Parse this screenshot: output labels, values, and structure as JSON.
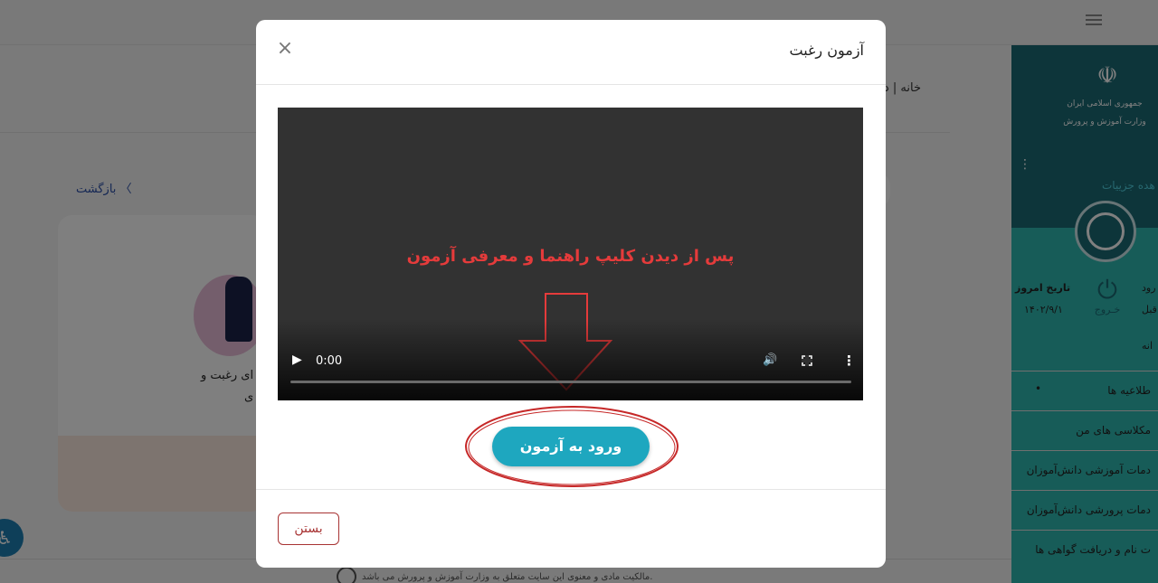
{
  "modal": {
    "title": "آزمون رغبت",
    "close_symbol": "×",
    "video": {
      "caption": "پس از دیدن کلیپ راهنما و معرفی آزمون",
      "time": "0:00",
      "play_symbol": "▶",
      "volume_symbol": "🔊",
      "more_symbol": "⋮"
    },
    "enter_button": "ورود به آزمون",
    "close_button": "بستن"
  },
  "background": {
    "breadcrumb": "خانه | د",
    "back_link": "بازگشت",
    "back_chevron": "〈",
    "card_text_line1": "ای رغبت و",
    "card_text_line2": "ی",
    "footer_text": "مالکیت مادی و معنوی این سایت متعلق به وزارت آموزش و پرورش می باشد.",
    "accessibility_symbol": "♿"
  },
  "sidebar": {
    "emblem_symbol": "☫",
    "gov_line1": "جمهوری اسلامی ایران",
    "gov_line2": "وزارت آموزش و پرورش",
    "kebab_symbol": "⋮",
    "details_link": "هده جزییات",
    "today_label": "تاریخ امروز",
    "today_date": "۱۴۰۲/۹/۱",
    "logout_symbol": "⏻",
    "logout_label": "خـروج",
    "partial_entry": "رود",
    "partial_prev": "قبل",
    "home_item": "انه",
    "items": [
      "طلاعیه ها",
      "مکلاسی های من",
      "دمات آموزشی دانش‌آموزان",
      "دمات پرورشی دانش‌آموزان",
      "ت نام و دریافت گواهی ها"
    ],
    "notice_dot": "•"
  },
  "colors": {
    "accent": "#1ea7bf",
    "sidebar_dark": "#1a6b75",
    "sidebar_light": "#2fb8b0",
    "danger": "#a83333",
    "annotation_red": "#e53b3b"
  }
}
